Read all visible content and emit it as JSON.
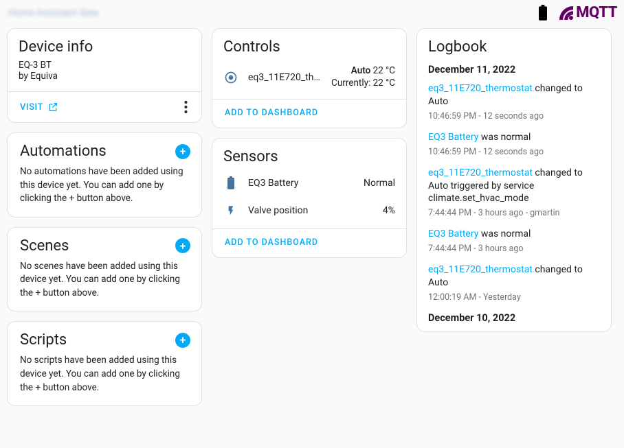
{
  "header": {
    "breadcrumb_blurred": "Home Assistant data",
    "mqtt_label": "MQTT"
  },
  "device_info": {
    "title": "Device info",
    "model": "EQ-3 BT",
    "manufacturer": "by Equiva",
    "visit_label": "VISIT"
  },
  "automations": {
    "title": "Automations",
    "empty": "No automations have been added using this device yet. You can add one by clicking the + button above."
  },
  "scenes": {
    "title": "Scenes",
    "empty": "No scenes have been added using this device yet. You can add one by clicking the + button above."
  },
  "scripts": {
    "title": "Scripts",
    "empty": "No scripts have been added using this device yet. You can add one by clicking the + button above."
  },
  "controls": {
    "title": "Controls",
    "add_label": "ADD TO DASHBOARD",
    "row": {
      "name": "eq3_11E720_therm…",
      "state_mode_label": "Auto",
      "state_mode_temp": "22 °C",
      "state_current_label": "Currently:",
      "state_current_temp": "22 °C"
    }
  },
  "sensors": {
    "title": "Sensors",
    "add_label": "ADD TO DASHBOARD",
    "rows": [
      {
        "name": "EQ3 Battery",
        "value": "Normal",
        "icon": "battery"
      },
      {
        "name": "Valve position",
        "value": "4%",
        "icon": "flash"
      }
    ]
  },
  "logbook": {
    "title": "Logbook",
    "entries": [
      {
        "type": "date",
        "text": "December 11, 2022"
      },
      {
        "type": "entry",
        "link": "eq3_11E720_thermostat",
        "rest": " changed to Auto",
        "meta": "10:46:59 PM - 12 seconds ago"
      },
      {
        "type": "entry",
        "link": "EQ3 Battery",
        "rest": " was normal",
        "meta": "10:46:59 PM - 12 seconds ago"
      },
      {
        "type": "entry",
        "link": "eq3_11E720_thermostat",
        "rest": " changed to Auto triggered by service climate.set_hvac_mode",
        "meta": "7:44:44 PM - 3 hours ago - gmartin"
      },
      {
        "type": "entry",
        "link": "EQ3 Battery",
        "rest": " was normal",
        "meta": "7:44:44 PM - 3 hours ago"
      },
      {
        "type": "entry",
        "link": "eq3_11E720_thermostat",
        "rest": " changed to Auto",
        "meta": "12:00:19 AM - Yesterday"
      },
      {
        "type": "date",
        "text": "December 10, 2022"
      }
    ]
  }
}
